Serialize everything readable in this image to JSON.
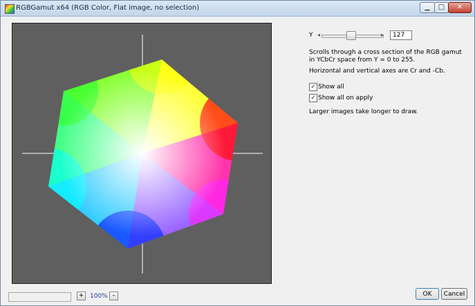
{
  "window": {
    "title": "RGBGamut x64 (RGB Color, Flat image, no selection)",
    "controls": {
      "minimize": "minimize-icon",
      "maximize": "maximize-icon",
      "close": "close-icon"
    }
  },
  "slider": {
    "label": "Y",
    "value": 127,
    "min": 0,
    "max": 255
  },
  "description": {
    "line1": "Scrolls through a cross section of the RGB gamut",
    "line2": "in YCbCr space from Y = 0 to 255.",
    "axes": "Horizontal and vertical axes are Cr and -Cb."
  },
  "options": {
    "show_all": {
      "label": "Show all",
      "checked": true
    },
    "show_all_on_apply": {
      "label": "Show all on apply",
      "checked": true
    }
  },
  "note": "Larger images take longer to draw.",
  "zoom": {
    "plus": "+",
    "level": "100%",
    "minus": "–"
  },
  "buttons": {
    "ok": "OK",
    "cancel": "Cancel"
  },
  "colors": {
    "preview_bg": "#5f5f5f",
    "axis": "#ffffff"
  }
}
